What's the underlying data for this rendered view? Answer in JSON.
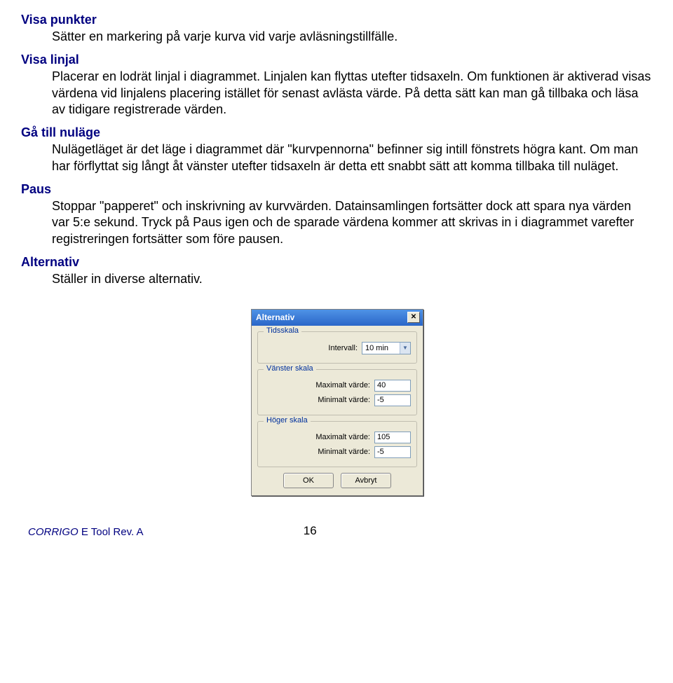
{
  "sections": {
    "visa_punkter": {
      "heading": "Visa  punkter",
      "body": "Sätter en markering på varje kurva vid varje avläsningstillfälle."
    },
    "visa_linjal": {
      "heading": "Visa linjal",
      "body": "Placerar en lodrät linjal i diagrammet. Linjalen kan flyttas utefter tidsaxeln. Om funktionen är aktiverad visas värdena vid linjalens placering istället för senast avlästa värde. På detta sätt kan man gå tillbaka och läsa av tidigare registrerade värden."
    },
    "ga_till_nulage": {
      "heading": "Gå till nuläge",
      "body": "Nulägetläget är det läge i diagrammet där \"kurvpennorna\" befinner sig intill fönstrets högra kant. Om man har förflyttat sig långt åt vänster utefter tidsaxeln är detta ett snabbt sätt att komma tillbaka till nuläget."
    },
    "paus": {
      "heading": "Paus",
      "body": "Stoppar \"papperet\" och inskrivning av kurvvärden. Datainsamlingen fortsätter dock att spara nya värden var 5:e sekund. Tryck på Paus igen och de sparade värdena kommer att skrivas in i diagrammet varefter registreringen fortsätter som före pausen."
    },
    "alternativ": {
      "heading": "Alternativ",
      "body": "Ställer in diverse alternativ."
    }
  },
  "dialog": {
    "title": "Alternativ",
    "groups": {
      "tidsskala": {
        "legend": "Tidsskala",
        "intervall_label": "Intervall:",
        "intervall_value": "10 min"
      },
      "vanster": {
        "legend": "Vänster skala",
        "max_label": "Maximalt värde:",
        "max_value": "40",
        "min_label": "Minimalt värde:",
        "min_value": "-5"
      },
      "hoger": {
        "legend": "Höger skala",
        "max_label": "Maximalt värde:",
        "max_value": "105",
        "min_label": "Minimalt värde:",
        "min_value": "-5"
      }
    },
    "ok": "OK",
    "cancel": "Avbryt"
  },
  "footer": {
    "product": "CORRIGO",
    "suffix": " E Tool  Rev. A",
    "page": "16"
  }
}
